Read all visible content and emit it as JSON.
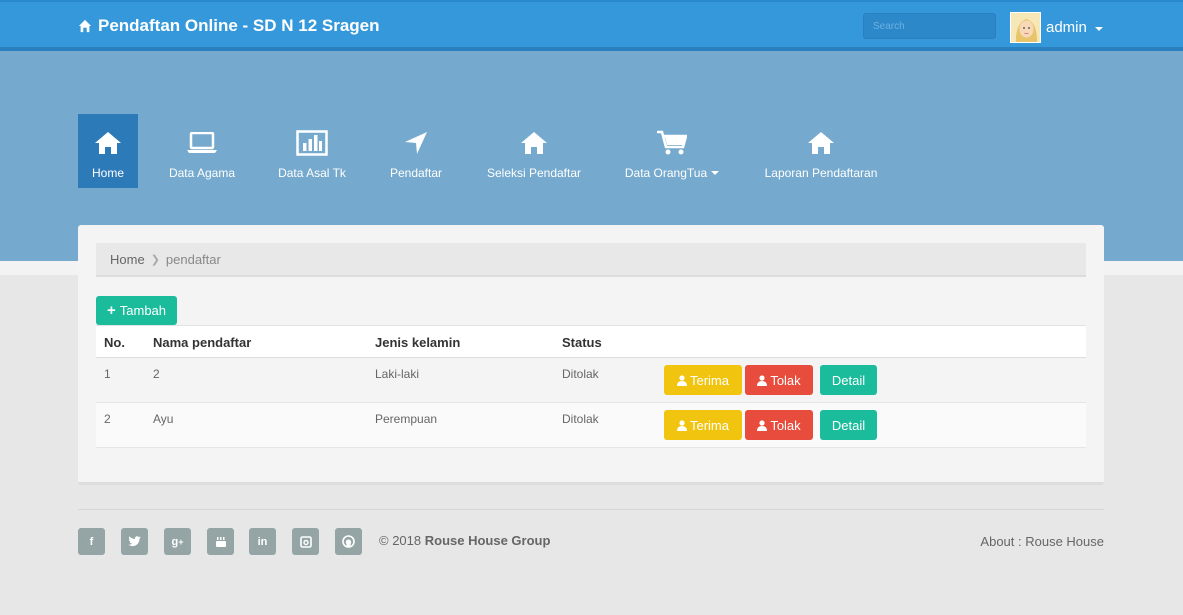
{
  "header": {
    "brand": "Pendaftan Online - SD N 12 Sragen",
    "search_placeholder": "Search",
    "user": "admin",
    "color": "#3498db"
  },
  "nav": [
    {
      "label": "Home",
      "icon": "home-icon",
      "active": true
    },
    {
      "label": "Data Agama",
      "icon": "laptop-icon"
    },
    {
      "label": "Data Asal Tk",
      "icon": "bar-chart-icon"
    },
    {
      "label": "Pendaftar",
      "icon": "location-arrow-icon"
    },
    {
      "label": "Seleksi Pendaftar",
      "icon": "home-icon"
    },
    {
      "label": "Data OrangTua",
      "icon": "shopping-cart-icon",
      "dropdown": true
    },
    {
      "label": "Laporan Pendaftaran",
      "icon": "home-icon"
    }
  ],
  "breadcrumb": {
    "home": "Home",
    "current": "pendaftar"
  },
  "add_button": "Tambah",
  "table": {
    "headers": [
      "No.",
      "Nama pendaftar",
      "Jenis kelamin",
      "Status"
    ],
    "rows": [
      {
        "no": "1",
        "nama": "2",
        "jk": "Laki-laki",
        "status": "Ditolak"
      },
      {
        "no": "2",
        "nama": "Ayu",
        "jk": "Perempuan",
        "status": "Ditolak"
      }
    ],
    "actions": {
      "terima": "Terima",
      "tolak": "Tolak",
      "detail": "Detail"
    }
  },
  "footer": {
    "social": [
      "facebook-icon",
      "twitter-icon",
      "google-plus-icon",
      "youtube-icon",
      "linkedin-icon",
      "instagram-icon",
      "github-icon"
    ],
    "copy_prefix": "© 2018",
    "copy_company": "Rouse House Group",
    "about": "About : Rouse House"
  }
}
